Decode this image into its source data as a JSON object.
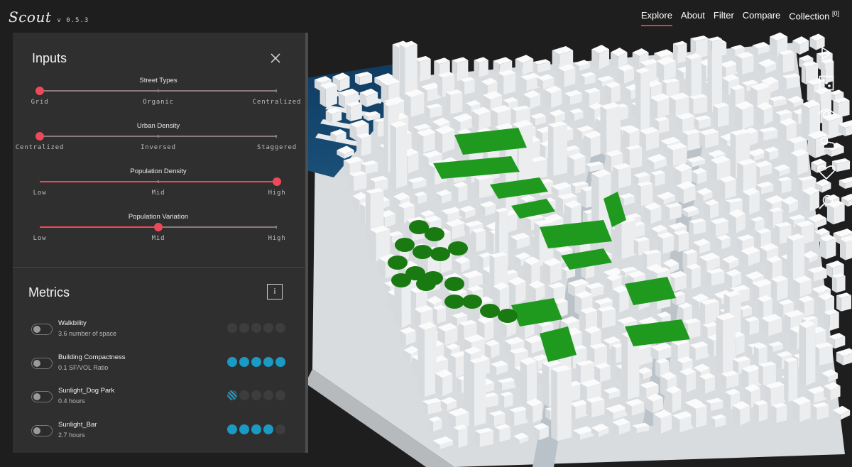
{
  "app": {
    "logo_text": "Scout",
    "version": "v 0.5.3"
  },
  "nav": {
    "items": [
      {
        "label": "Explore",
        "active": true
      },
      {
        "label": "About",
        "active": false
      },
      {
        "label": "Filter",
        "active": false
      },
      {
        "label": "Compare",
        "active": false
      },
      {
        "label": "Collection",
        "active": false
      }
    ],
    "collection_count": "[0]"
  },
  "rail_icons": [
    "play-icon",
    "dice-icon",
    "eye-icon",
    "weather-icon",
    "heart-icon",
    "search-icon"
  ],
  "inputs": {
    "title": "Inputs",
    "sliders": [
      {
        "title": "Street Types",
        "labels": [
          "Grid",
          "Organic",
          "Centralized"
        ],
        "value": 0.0
      },
      {
        "title": "Urban Density",
        "labels": [
          "Centralized",
          "Inversed",
          "Staggered"
        ],
        "value": 0.0
      },
      {
        "title": "Population Density",
        "labels": [
          "Low",
          "Mid",
          "High"
        ],
        "value": 1.0
      },
      {
        "title": "Population Variation",
        "labels": [
          "Low",
          "Mid",
          "High"
        ],
        "value": 0.5
      }
    ]
  },
  "metrics": {
    "title": "Metrics",
    "info_label": "i",
    "items": [
      {
        "name": "Walkbility",
        "value": "3.6 number of space",
        "score": 0
      },
      {
        "name": "Building Compactness",
        "value": "0.1 SF/VOL Ratio",
        "score": 5
      },
      {
        "name": "Sunlight_Dog Park",
        "value": "0.4 hours",
        "score": 0.7
      },
      {
        "name": "Sunlight_Bar",
        "value": "2.7 hours",
        "score": 4
      }
    ]
  },
  "colors": {
    "accent": "#ec4a5a",
    "metric_on": "#1b9ac4",
    "park_green": "#1f9a1f",
    "water": "#1a4f78",
    "background": "#1e1e1e"
  }
}
